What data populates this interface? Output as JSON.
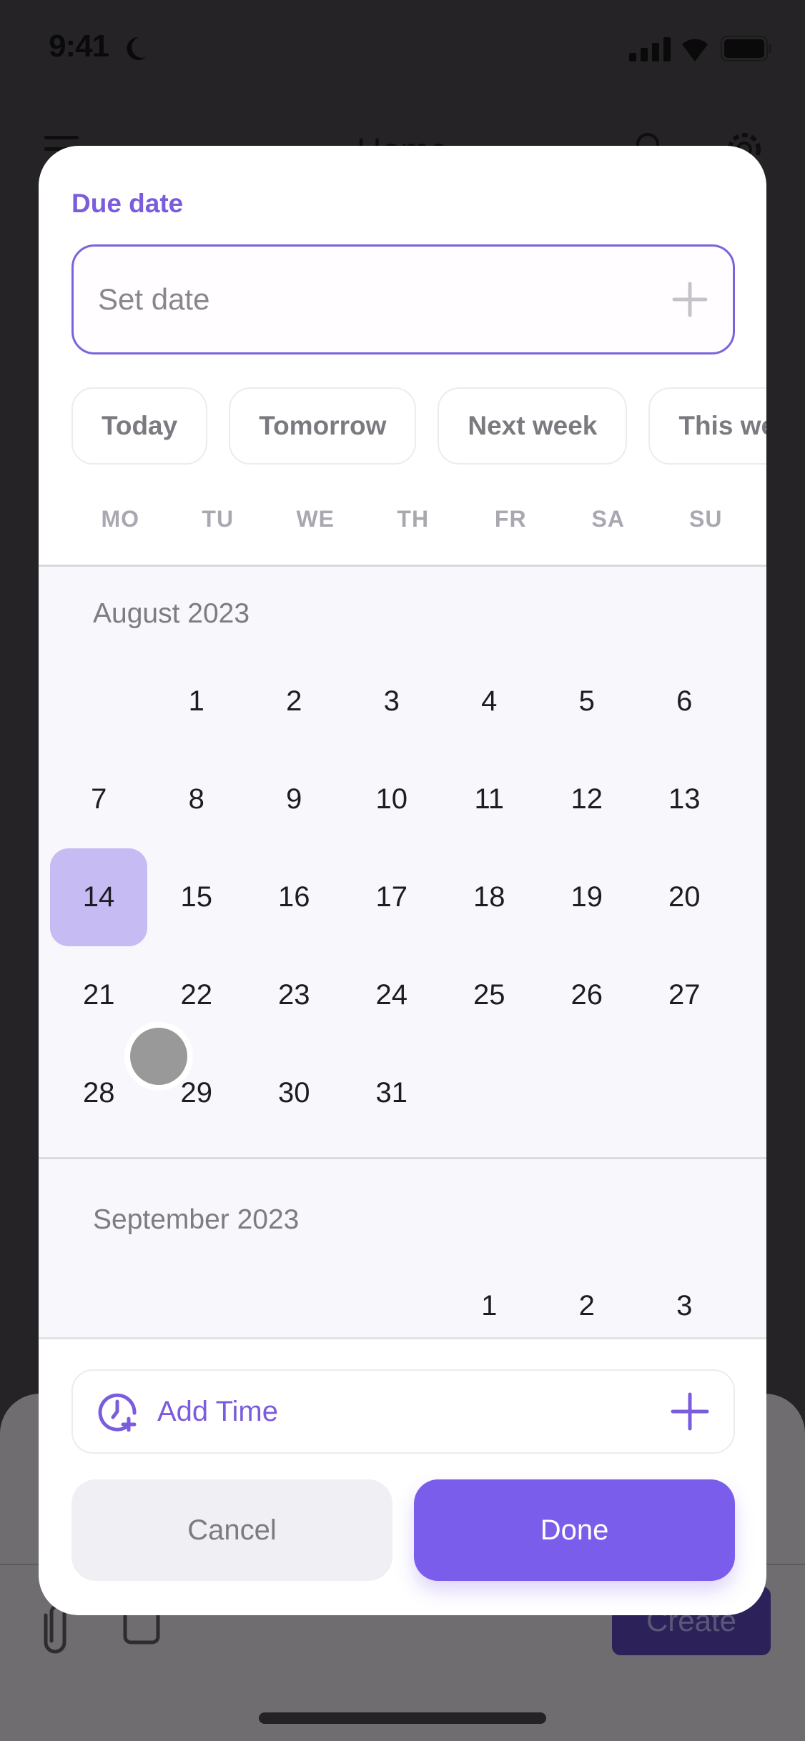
{
  "status_bar": {
    "time": "9:41",
    "icons": [
      "moon-icon",
      "signal-icon",
      "wifi-icon",
      "battery-icon"
    ]
  },
  "app_header": {
    "title": "Home",
    "icons": [
      "menu-icon",
      "search-icon",
      "gear-icon"
    ]
  },
  "background_sheet": {
    "create_label": "Create",
    "icons": [
      "attach-icon",
      "calendar-icon"
    ]
  },
  "modal": {
    "section_label": "Due date",
    "date_input": {
      "value": "",
      "placeholder": "Set date"
    },
    "quick_options": [
      {
        "label": "Today"
      },
      {
        "label": "Tomorrow"
      },
      {
        "label": "Next week"
      },
      {
        "label": "This weekend"
      }
    ],
    "weekdays": [
      "MO",
      "TU",
      "WE",
      "TH",
      "FR",
      "SA",
      "SU"
    ],
    "months": [
      {
        "title": "August 2023",
        "leading_blanks": 1,
        "days": [
          "1",
          "2",
          "3",
          "4",
          "5",
          "6",
          "7",
          "8",
          "9",
          "10",
          "11",
          "12",
          "13",
          "14",
          "15",
          "16",
          "17",
          "18",
          "19",
          "20",
          "21",
          "22",
          "23",
          "24",
          "25",
          "26",
          "27",
          "28",
          "29",
          "30",
          "31"
        ],
        "selected_day": "14"
      },
      {
        "title": "September 2023",
        "leading_blanks": 4,
        "days": [
          "1",
          "2",
          "3"
        ]
      }
    ],
    "add_time_label": "Add Time",
    "cancel_label": "Cancel",
    "done_label": "Done"
  },
  "colors": {
    "accent": "#7b5deb",
    "accent_text": "#7a5cdc",
    "selected_day": "#c7bbf4",
    "calendar_bg": "#f8f7fc",
    "cancel_bg": "#f0eff4"
  }
}
